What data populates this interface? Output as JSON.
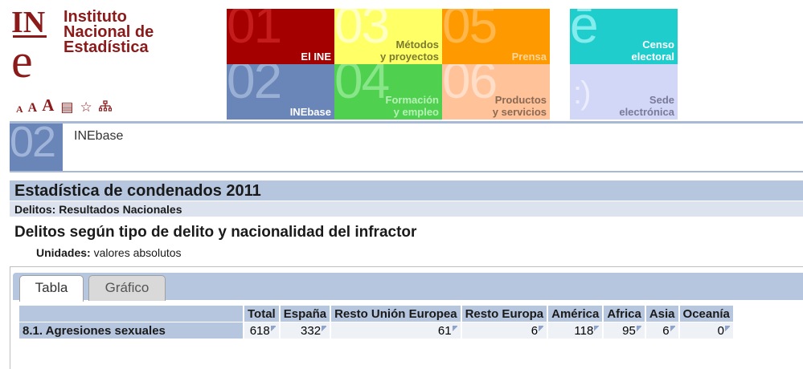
{
  "logo": {
    "line1": "Instituto",
    "line2": "Nacional de",
    "line3": "Estadística",
    "mark_top": "IN",
    "mark_bottom": "e",
    "brand_color": "#8b1a1a"
  },
  "tools": {
    "font_small": "A",
    "font_medium": "A",
    "font_large": "A",
    "icons": [
      "list-icon",
      "star-icon",
      "sitemap-icon"
    ]
  },
  "nav": {
    "tiles": [
      {
        "num": "01",
        "label": "El INE",
        "color": "#a50000"
      },
      {
        "num": "03",
        "label_line1": "Métodos",
        "label_line2": "y proyectos",
        "color": "#ffff66"
      },
      {
        "num": "05",
        "label": "Prensa",
        "color": "#ff9900"
      },
      {
        "num": "02",
        "label": "INEbase",
        "color": "#6a86b8"
      },
      {
        "num": "04",
        "label_line1": "Formación",
        "label_line2": "y empleo",
        "color": "#4fd14f"
      },
      {
        "num": "06",
        "label_line1": "Productos",
        "label_line2": "y servicios",
        "color": "#ffc299"
      },
      {
        "num": "ē",
        "label_line1": "Censo",
        "label_line2": "electoral",
        "color": "#1fcdcd"
      },
      {
        "num": ":)",
        "label_line1": "Sede",
        "label_line2": "electrónica",
        "color": "#d3d7f7"
      }
    ]
  },
  "section": {
    "num": "02",
    "title": "INEbase"
  },
  "page": {
    "stat_title": "Estadística de condenados 2011",
    "subtitle": "Delitos: Resultados Nacionales",
    "table_title": "Delitos según tipo de delito y nacionalidad del infractor",
    "units_label": "Unidades:",
    "units_value": " valores absolutos"
  },
  "tabs": {
    "table": "Tabla",
    "chart": "Gráfico"
  },
  "table": {
    "headers": [
      "Total",
      "España",
      "Resto Unión Europea",
      "Resto Europa",
      "América",
      "Africa",
      "Asia",
      "Oceanía"
    ],
    "rows": [
      {
        "label": "8.1. Agresiones sexuales",
        "values": [
          "618",
          "332",
          "61",
          "6",
          "118",
          "95",
          "6",
          "0"
        ]
      }
    ]
  }
}
